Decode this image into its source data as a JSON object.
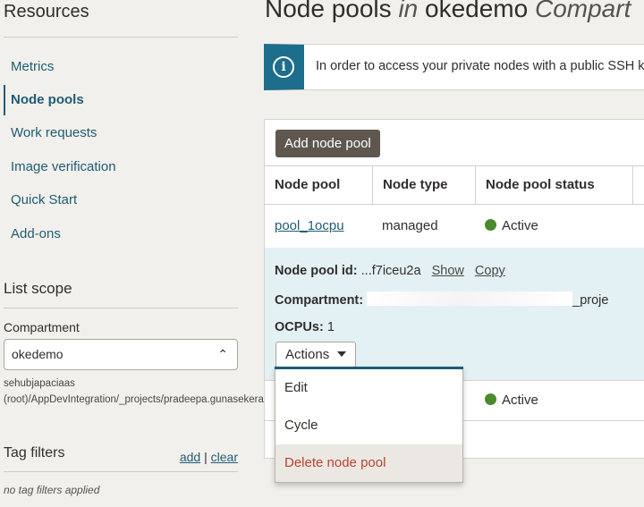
{
  "sidebar": {
    "title": "Resources",
    "items": [
      {
        "label": "Metrics"
      },
      {
        "label": "Node pools"
      },
      {
        "label": "Work requests"
      },
      {
        "label": "Image verification"
      },
      {
        "label": "Quick Start"
      },
      {
        "label": "Add-ons"
      }
    ],
    "list_scope": "List scope",
    "compartment_label": "Compartment",
    "compartment_value": "okedemo",
    "compartment_path": "sehubjapaciaas (root)/AppDevIntegration/_projects/pradeepa.gunasekera/okedemo",
    "tag_filters": "Tag filters",
    "tag_add": "add",
    "tag_sep": "|",
    "tag_clear": "clear",
    "tag_empty": "no tag filters applied"
  },
  "header": {
    "title_pre": "Node pools ",
    "title_in": "in",
    "title_name": " okedemo ",
    "title_post": "Compart"
  },
  "banner": {
    "icon": "info-icon",
    "message": "In order to access your private nodes with a public SSH k"
  },
  "table": {
    "add_button": "Add node pool",
    "columns": [
      "Node pool",
      "Node type",
      "Node pool status",
      "I"
    ],
    "rows": [
      {
        "name": "pool_1ocpu",
        "type": "managed",
        "status": "Active"
      },
      {
        "status": "Active"
      }
    ],
    "detail": {
      "id_label": "Node pool id:",
      "id_value": "...f7iceu2a",
      "show": "Show",
      "copy": "Copy",
      "compartment_label": "Compartment:",
      "compartment_tail": "_proje",
      "ocpus_label": "OCPUs:",
      "ocpus_value": "1",
      "actions": "Actions"
    }
  },
  "menu": {
    "items": [
      "Edit",
      "Cycle",
      "Delete node pool"
    ]
  },
  "colors": {
    "accent": "#1f5c73",
    "active": "#4b8a2c",
    "danger": "#b9422f"
  }
}
